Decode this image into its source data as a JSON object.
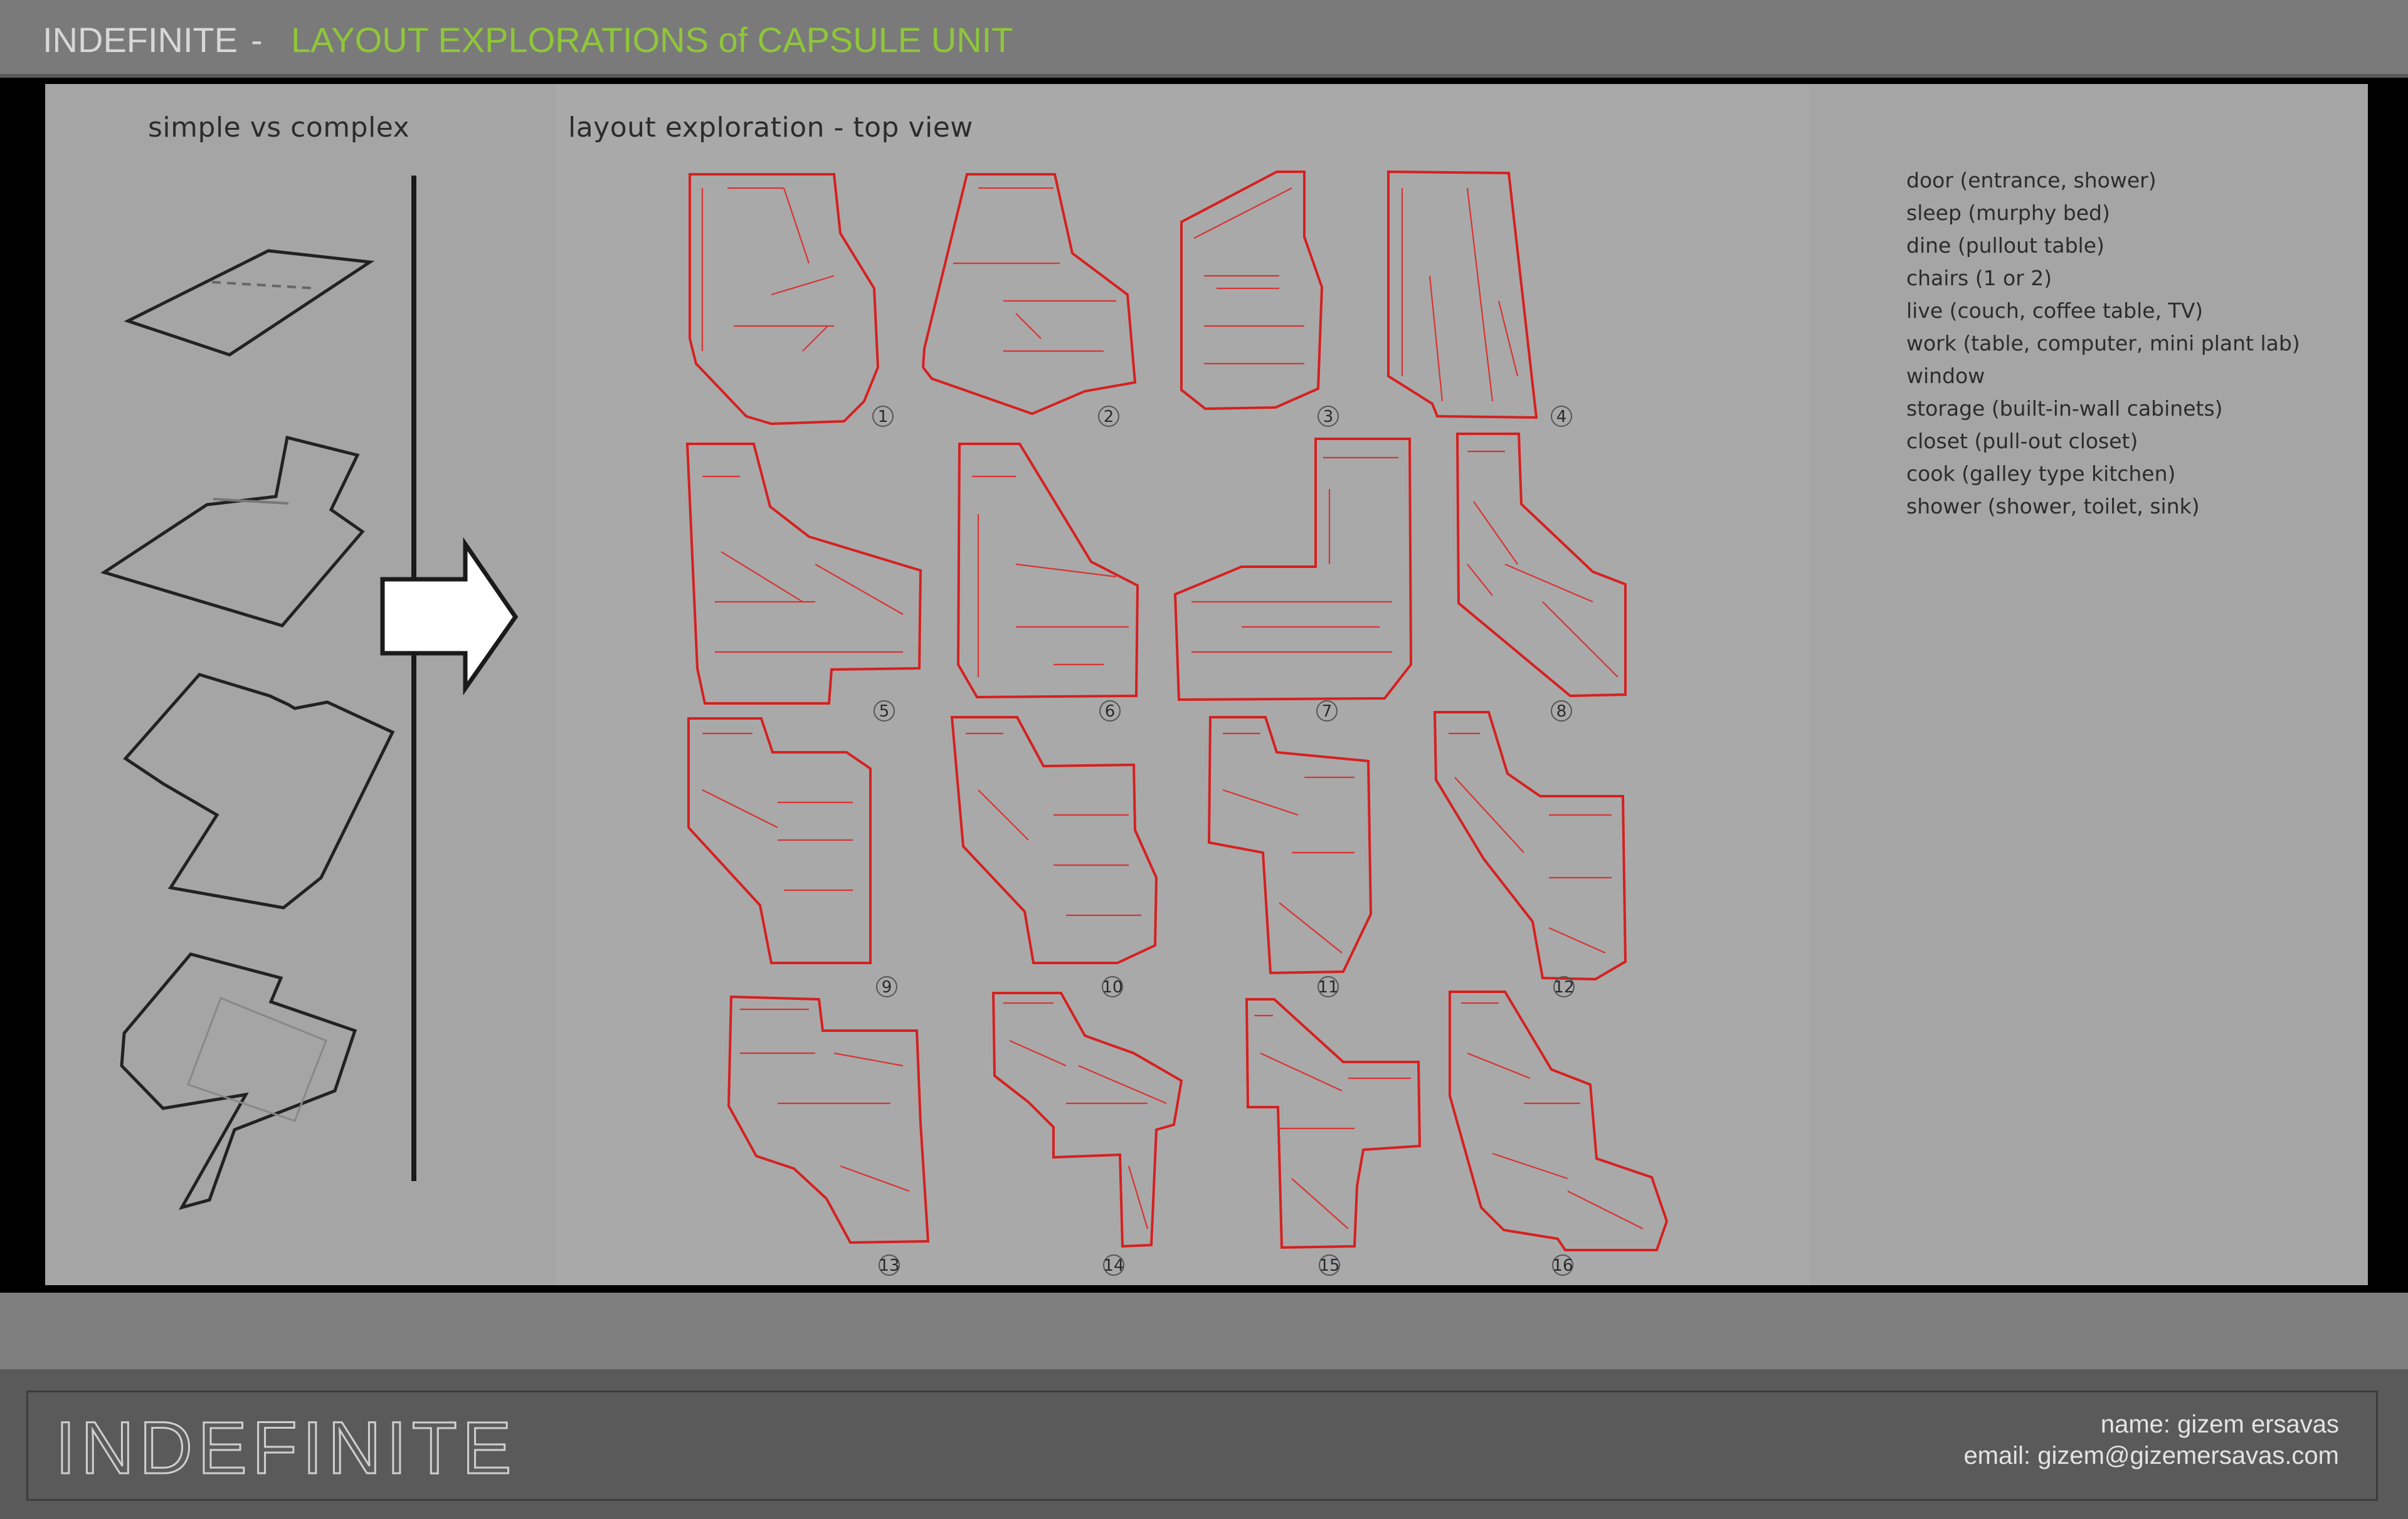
{
  "header": {
    "brand": "INDEFINITE",
    "separator": "-",
    "subject": "LAYOUT EXPLORATIONS of CAPSULE UNIT",
    "colors": {
      "brand": "#d7d7d7",
      "subject": "#8fc63a"
    }
  },
  "left_panel": {
    "title": "simple vs complex"
  },
  "middle_panel": {
    "title": "layout exploration - top view",
    "plan_numbers": [
      "1",
      "2",
      "3",
      "4",
      "5",
      "6",
      "7",
      "8",
      "9",
      "10",
      "11",
      "12",
      "13",
      "14",
      "15",
      "16"
    ],
    "plan_color": "#d62020"
  },
  "legend": {
    "items": [
      "door (entrance, shower)",
      "sleep (murphy bed)",
      "dine (pullout table)",
      "chairs (1 or 2)",
      "live (couch, coffee table, TV)",
      "work (table, computer, mini plant lab)",
      "window",
      "storage (built-in-wall cabinets)",
      "closet (pull-out closet)",
      "cook (galley type kitchen)",
      "shower (shower, toilet, sink)"
    ]
  },
  "footer": {
    "logo": "INDEFINITE",
    "name_line": "name:  gizem ersavas",
    "email_line": "email:  gizem@gizemersavas.com"
  }
}
